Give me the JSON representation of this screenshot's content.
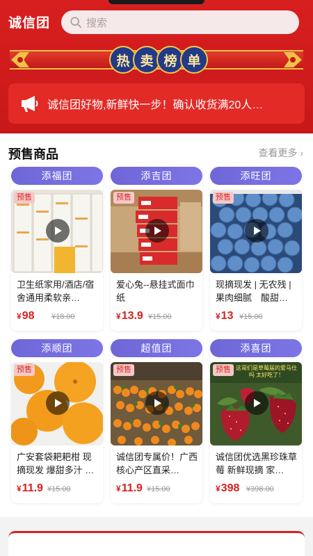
{
  "header": {
    "app_name": "诚信团",
    "search_placeholder": "搜索",
    "banner_words": [
      "热",
      "卖",
      "榜",
      "单"
    ],
    "notice_text": "诚信团好物,新鲜快一步！确认收货满20人…"
  },
  "section": {
    "title": "预售商品",
    "see_more": "查看更多",
    "see_more_arrow": "›"
  },
  "products": [
    {
      "tab": "添福团",
      "tag": "预售",
      "title": "卫生纸家用/酒店/宿舍通用柔软亲…",
      "currency": "¥",
      "price": "98",
      "old_price": "¥18.00"
    },
    {
      "tab": "添吉团",
      "tag": "预售",
      "title": "爱心兔--悬挂式面巾纸",
      "currency": "¥",
      "price": "13.9",
      "old_price": "¥15.00"
    },
    {
      "tab": "添旺团",
      "tag": "预售",
      "title": "现摘现发 | 无农残 | 果肉细腻　酸甜…",
      "currency": "¥",
      "price": "13",
      "old_price": "¥15.00"
    },
    {
      "tab": "添顺团",
      "tag": "预售",
      "title": "广安套袋耙耙柑 现摘现发 爆甜多汁 …",
      "currency": "¥",
      "price": "11.9",
      "old_price": "¥15.00"
    },
    {
      "tab": "超值团",
      "tag": "预售",
      "title": "诚信团专属价！广西核心产区直采…",
      "currency": "¥",
      "price": "11.9",
      "old_price": "¥15.00"
    },
    {
      "tab": "添喜团",
      "tag": "预售",
      "title": "诚信团优选黑珍珠草莓 新鲜现摘 家…",
      "currency": "¥",
      "price": "398",
      "old_price": "¥398.00",
      "image_caption": "这哥们是草莓届的爱马仕吗 太好吃了！"
    }
  ],
  "colors": {
    "brand_red": "#d81f1f",
    "tab_purple": "#7068da",
    "price_red": "#d62020"
  }
}
